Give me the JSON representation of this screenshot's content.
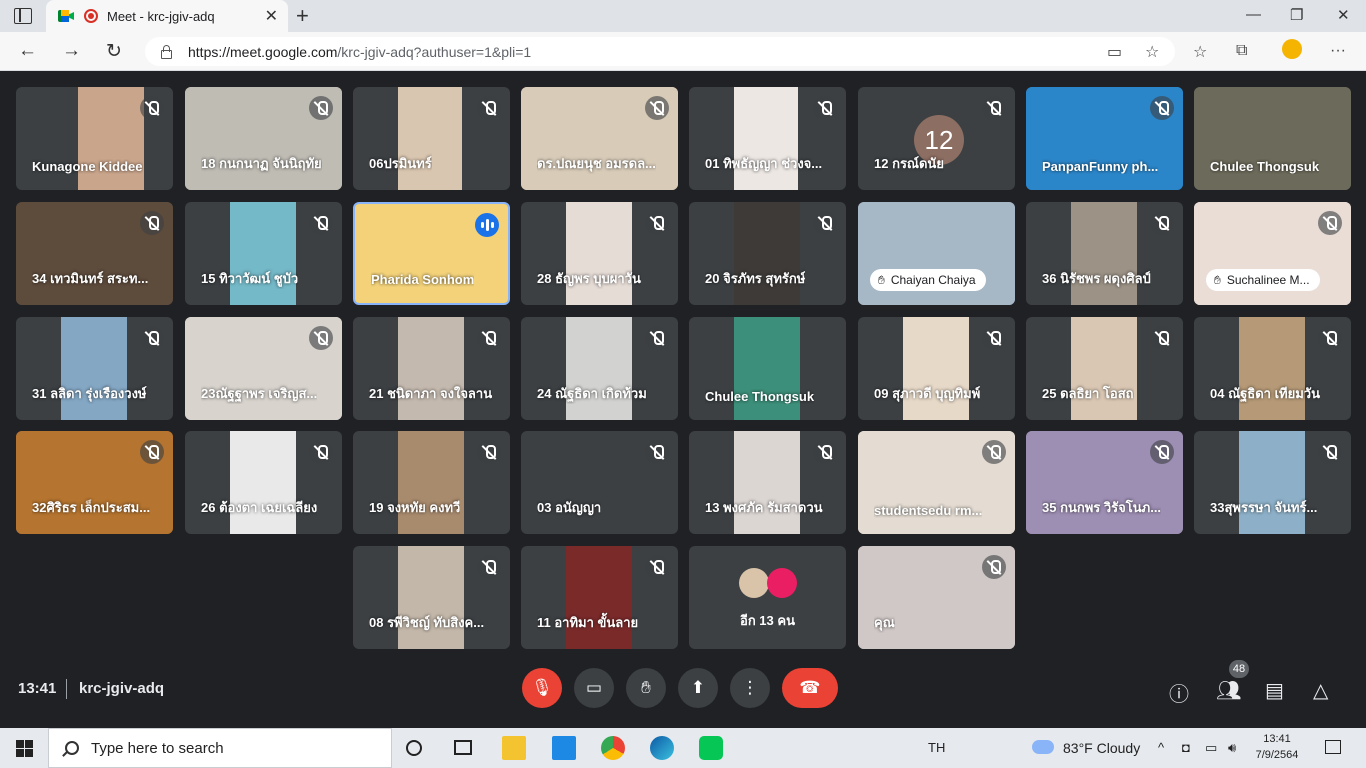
{
  "browser": {
    "tab_title": "Meet - krc-jgiv-adq",
    "tab_close": "✕",
    "new_tab": "+",
    "url_host": "https://meet.google.com",
    "url_path": "/krc-jgiv-adq?authuser=1&pli=1",
    "window_controls": [
      "—",
      "❐",
      "✕"
    ]
  },
  "meeting": {
    "time": "13:41",
    "code": "krc-jgiv-adq",
    "participant_count": "48"
  },
  "tiles": [
    {
      "name": "Kunagone Kiddee",
      "muted": true
    },
    {
      "name": "18 กนกนาฏ จันนิฤทัย",
      "muted": true
    },
    {
      "name": "06ปรมินทร์",
      "muted": true
    },
    {
      "name": "ดร.ปณยนุช อมรดล...",
      "muted": true
    },
    {
      "name": "01 ทิพธัญญา ช่วงจ...",
      "muted": true
    },
    {
      "name": "12 กรณ์ดนัย",
      "muted": true,
      "avatar": "12"
    },
    {
      "name": "PanpanFunny ph...",
      "muted": true
    },
    {
      "name": "Chulee Thongsuk",
      "muted": false
    },
    {
      "name": "34 เทวมินทร์ สระท...",
      "muted": true
    },
    {
      "name": "15 ทิวาวัฒน์ ชูบัว",
      "muted": true
    },
    {
      "name": "Pharida Sonhom",
      "muted": false,
      "speaking": true
    },
    {
      "name": "28 ธัญพร บุบผาวัน",
      "muted": true
    },
    {
      "name": "20 จิรภัทร สุทรักษ์",
      "muted": true
    },
    {
      "name": "Chaiyan Chaiya",
      "muted": false,
      "hand": true
    },
    {
      "name": "36 นิรัชพร ผดุงศิลป์",
      "muted": true
    },
    {
      "name": "Suchalinee M...",
      "muted": true,
      "hand": true
    },
    {
      "name": "31 ลลิดา รุ่งเรืองวงษ์",
      "muted": true
    },
    {
      "name": "23ณัฐฐาพร เจริญส...",
      "muted": true
    },
    {
      "name": "21 ชนิดาภา จงใจลาน",
      "muted": true
    },
    {
      "name": "24 ณัฐธิดา เกิดท้วม",
      "muted": true
    },
    {
      "name": "Chulee Thongsuk",
      "muted": false
    },
    {
      "name": "09 สุภาวดี บุญทิมพ์",
      "muted": true
    },
    {
      "name": "25 ดลธิยา โอสถ",
      "muted": true
    },
    {
      "name": "04 ณัฐธิดา เทียมวัน",
      "muted": true
    },
    {
      "name": "32ศิริธร เล็กประสม...",
      "muted": true
    },
    {
      "name": "26 ต้องตา เฉยเฉลียง",
      "muted": true
    },
    {
      "name": "19 จงหทัย คงทวี",
      "muted": true
    },
    {
      "name": "03 อนัญญา",
      "muted": true
    },
    {
      "name": "13 พงศภัค รัมสาดวน",
      "muted": true
    },
    {
      "name": "studentsedu rm...",
      "muted": true
    },
    {
      "name": "35 กนกพร วิรัจโนภ...",
      "muted": true
    },
    {
      "name": "33สุพรรษา จันทร์...",
      "muted": true
    },
    {
      "name": "08 รพีวิชญ์ ทับสิงค...",
      "muted": true
    },
    {
      "name": "11 อาทิมา ขั้นลาย",
      "muted": true
    },
    {
      "name": "อีก 13 คน",
      "more": true
    },
    {
      "name": "คุณ",
      "muted": true
    }
  ],
  "taskbar": {
    "search_placeholder": "Type here to search",
    "lang": "TH",
    "weather": "83°F  Cloudy",
    "clock_time": "13:41",
    "clock_date": "7/9/2564"
  },
  "colors": {
    "meet_bg": "#202124",
    "tile_bg": "#3c4043",
    "red": "#ea4335",
    "blue": "#1a73e8"
  }
}
